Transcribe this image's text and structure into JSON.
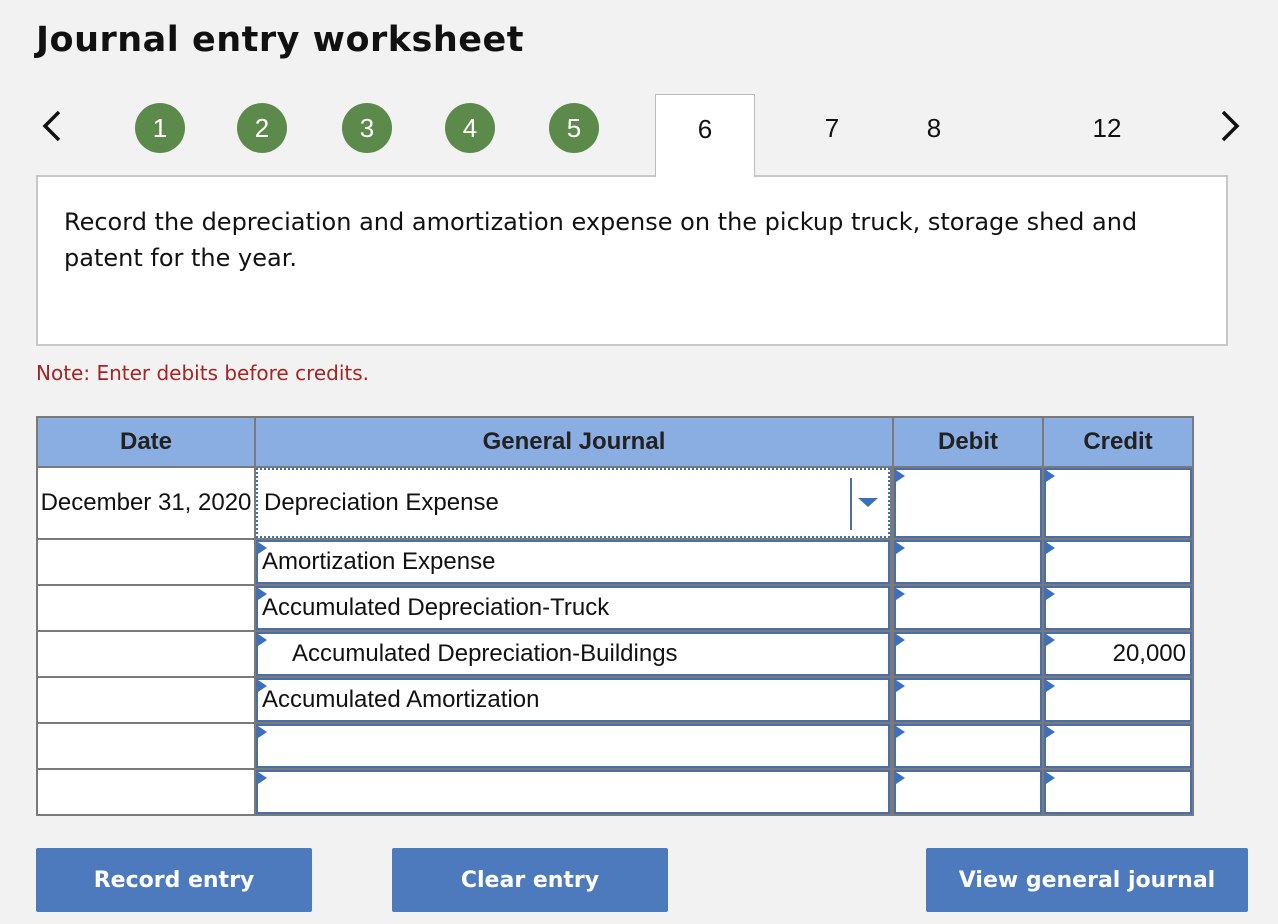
{
  "title": "Journal entry worksheet",
  "nav": {
    "completed_steps": [
      "1",
      "2",
      "3",
      "4",
      "5"
    ],
    "active_step": "6",
    "other_steps": [
      "7",
      "8",
      "12"
    ]
  },
  "instruction": "Record the depreciation and amortization expense on the pickup truck, storage shed and patent for the year.",
  "note": "Note: Enter debits before credits.",
  "table": {
    "headers": {
      "date": "Date",
      "journal": "General Journal",
      "debit": "Debit",
      "credit": "Credit"
    },
    "rows": [
      {
        "date": "December 31, 2020",
        "account": "Depreciation Expense",
        "debit": "",
        "credit": ""
      },
      {
        "date": "",
        "account": "Amortization Expense",
        "debit": "",
        "credit": ""
      },
      {
        "date": "",
        "account": "Accumulated Depreciation-Truck",
        "debit": "",
        "credit": ""
      },
      {
        "date": "",
        "account": "Accumulated Depreciation-Buildings",
        "debit": "",
        "credit": "20,000"
      },
      {
        "date": "",
        "account": "Accumulated Amortization",
        "debit": "",
        "credit": ""
      },
      {
        "date": "",
        "account": "",
        "debit": "",
        "credit": ""
      },
      {
        "date": "",
        "account": "",
        "debit": "",
        "credit": ""
      }
    ]
  },
  "buttons": {
    "record": "Record entry",
    "clear": "Clear entry",
    "view": "View general journal"
  },
  "colors": {
    "completed_step": "#5b8a4b",
    "header_bg": "#8aaee2",
    "button_bg": "#4d79bd",
    "note_text": "#a72323"
  },
  "icons": {
    "prev": "chevron-left-icon",
    "next": "chevron-right-icon",
    "dropdown": "caret-down-icon",
    "cell_marker": "triangle-marker-icon"
  }
}
